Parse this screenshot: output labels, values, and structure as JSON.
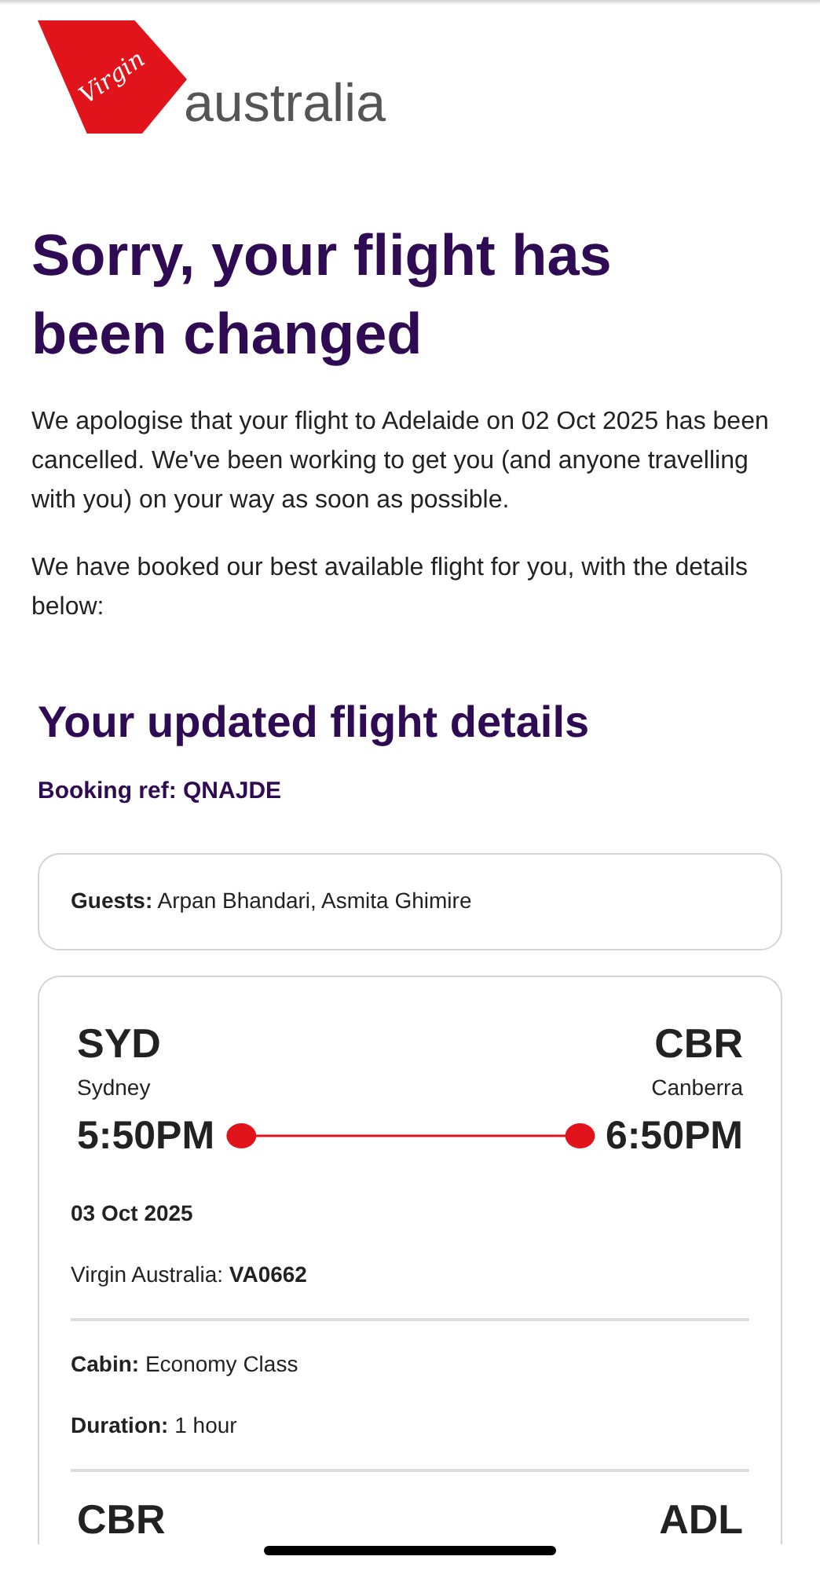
{
  "logo": {
    "script": "Virgin",
    "wordmark": "australia"
  },
  "heading": "Sorry, your flight has been changed",
  "paragraphs": [
    "We apologise that your flight to Adelaide on 02 Oct 2025 has been cancelled. We've been working to get you (and anyone travelling with you) on your way as soon as possible.",
    "We have booked our best available flight for you, with the details below:"
  ],
  "section_title": "Your updated flight details",
  "booking_ref": {
    "label": "Booking ref:",
    "value": "QNAJDE"
  },
  "guests": {
    "label": "Guests:",
    "value": "Arpan Bhandari, Asmita Ghimire"
  },
  "segments": [
    {
      "from_code": "SYD",
      "from_city": "Sydney",
      "to_code": "CBR",
      "to_city": "Canberra",
      "depart": "5:50PM",
      "arrive": "6:50PM",
      "date": "03 Oct 2025",
      "carrier": "Virgin Australia:",
      "flight_number": "VA0662",
      "cabin_label": "Cabin:",
      "cabin": "Economy Class",
      "duration_label": "Duration:",
      "duration": "1 hour"
    },
    {
      "from_code": "CBR",
      "to_code": "ADL"
    }
  ]
}
